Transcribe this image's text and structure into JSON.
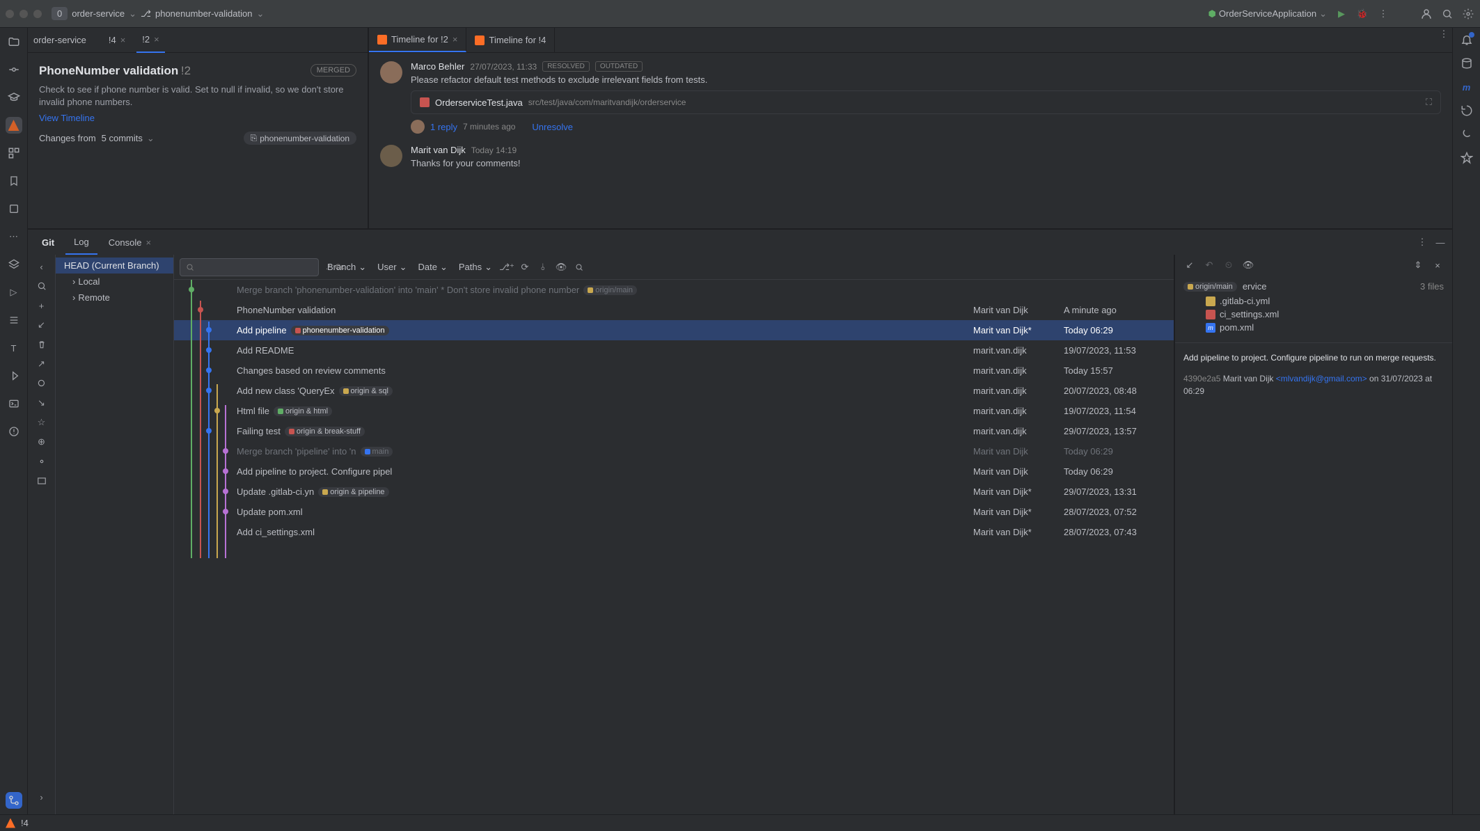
{
  "topbar": {
    "box_number": "0",
    "project": "order-service",
    "branch": "phonenumber-validation",
    "run_config": "OrderServiceApplication"
  },
  "mr": {
    "breadcrumb": "order-service",
    "tab1": "!4",
    "tab2": "!2",
    "title": "PhoneNumber validation",
    "id": "!2",
    "status": "MERGED",
    "description": "Check to see if phone number is valid. Set to null if invalid, so we don't store invalid phone numbers.",
    "view_timeline": "View Timeline",
    "changes_from": "Changes from",
    "commits": "5 commits",
    "tag": "phonenumber-validation"
  },
  "timeline": {
    "tab1": "Timeline for !2",
    "tab2": "Timeline for !4",
    "c1_author": "Marco Behler",
    "c1_time": "27/07/2023, 11:33",
    "c1_badge1": "RESOLVED",
    "c1_badge2": "OUTDATED",
    "c1_text": "Please refactor default test methods to exclude irrelevant fields from tests.",
    "file_name": "OrderserviceTest.java",
    "file_path": "src/test/java/com/maritvandijk/orderservice",
    "reply_count": "1 reply",
    "reply_time": "7 minutes ago",
    "unresolve": "Unresolve",
    "c2_author": "Marit van Dijk",
    "c2_time": "Today 14:19",
    "c2_text": "Thanks for your comments!"
  },
  "git": {
    "tab_git": "Git",
    "tab_log": "Log",
    "tab_console": "Console",
    "regex": ".*",
    "cc": "Cc",
    "f_branch": "Branch",
    "f_user": "User",
    "f_date": "Date",
    "f_paths": "Paths",
    "branch_head": "HEAD (Current Branch)",
    "branch_local": "Local",
    "branch_remote": "Remote",
    "commits": [
      {
        "msg": "Merge branch 'phonenumber-validation' into 'main' * Don't store invalid phone number",
        "tag": "origin/main",
        "author": "",
        "date": "",
        "dim": true
      },
      {
        "msg": "PhoneNumber validation",
        "author": "Marit van Dijk",
        "date": "A minute ago"
      },
      {
        "msg": "Add pipeline",
        "tag": "phonenumber-validation",
        "author": "Marit van Dijk*",
        "date": "Today 06:29",
        "sel": true
      },
      {
        "msg": "Add README",
        "author": "marit.van.dijk",
        "date": "19/07/2023, 11:53"
      },
      {
        "msg": "Changes based on review comments",
        "author": "marit.van.dijk",
        "date": "Today 15:57"
      },
      {
        "msg": "Add new class 'QueryEx",
        "tag": "origin & sql",
        "author": "marit.van.dijk",
        "date": "20/07/2023, 08:48"
      },
      {
        "msg": "Html file",
        "tag": "origin & html",
        "author": "marit.van.dijk",
        "date": "19/07/2023, 11:54"
      },
      {
        "msg": "Failing test",
        "tag": "origin & break-stuff",
        "author": "marit.van.dijk",
        "date": "29/07/2023, 13:57"
      },
      {
        "msg": "Merge branch 'pipeline' into 'n",
        "tag": "main",
        "author": "Marit van Dijk",
        "date": "Today 06:29",
        "dim": true
      },
      {
        "msg": "Add pipeline to project. Configure pipel",
        "author": "Marit van Dijk",
        "date": "Today 06:29"
      },
      {
        "msg": "Update .gitlab-ci.yn",
        "tag": "origin & pipeline",
        "author": "Marit van Dijk*",
        "date": "29/07/2023, 13:31"
      },
      {
        "msg": "Update pom.xml",
        "author": "Marit van Dijk*",
        "date": "28/07/2023, 07:52"
      },
      {
        "msg": "Add ci_settings.xml",
        "author": "Marit van Dijk*",
        "date": "28/07/2023, 07:43"
      }
    ]
  },
  "details": {
    "folder": "ervice",
    "count": "3 files",
    "f1": ".gitlab-ci.yml",
    "f2": "ci_settings.xml",
    "f3": "pom.xml",
    "commit_msg": "Add pipeline to project. Configure pipeline to run on merge requests.",
    "hash": "4390e2a5",
    "commit_author": "Marit van Dijk",
    "email": "<mlvandijk@gmail.com>",
    "on": "on",
    "date": "31/07/2023 at 06:29"
  },
  "status": {
    "mr": "!4"
  }
}
